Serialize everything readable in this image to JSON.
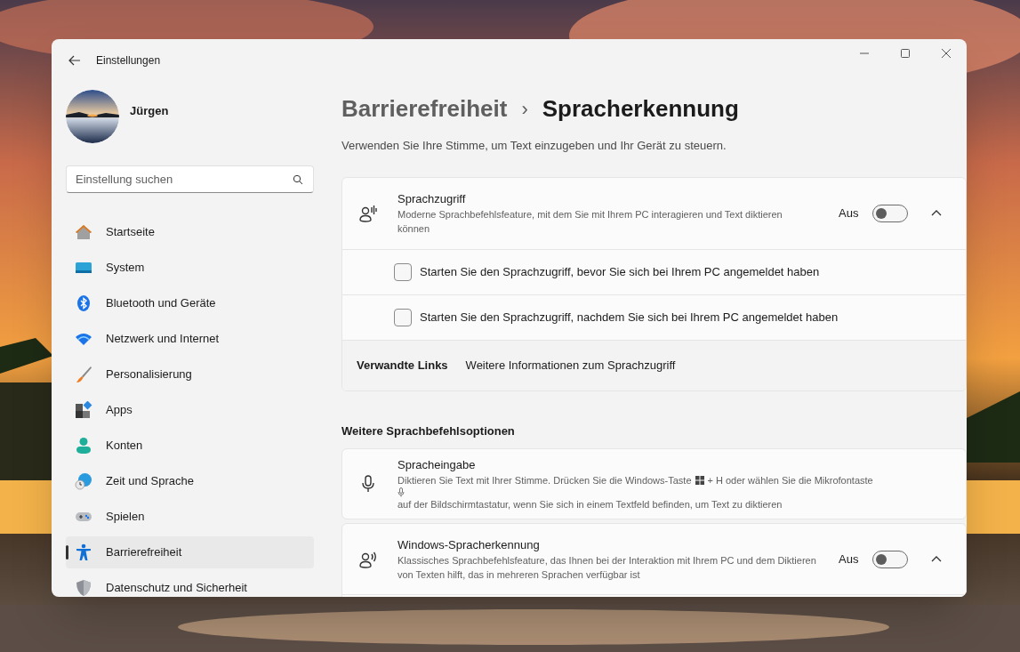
{
  "window": {
    "title": "Einstellungen"
  },
  "user": {
    "name": "Jürgen"
  },
  "search": {
    "placeholder": "Einstellung suchen"
  },
  "nav": [
    {
      "label": "Startseite",
      "selected": false
    },
    {
      "label": "System",
      "selected": false
    },
    {
      "label": "Bluetooth und Geräte",
      "selected": false
    },
    {
      "label": "Netzwerk und Internet",
      "selected": false
    },
    {
      "label": "Personalisierung",
      "selected": false
    },
    {
      "label": "Apps",
      "selected": false
    },
    {
      "label": "Konten",
      "selected": false
    },
    {
      "label": "Zeit und Sprache",
      "selected": false
    },
    {
      "label": "Spielen",
      "selected": false
    },
    {
      "label": "Barrierefreiheit",
      "selected": true
    },
    {
      "label": "Datenschutz und Sicherheit",
      "selected": false
    }
  ],
  "breadcrumb": {
    "parent": "Barrierefreiheit",
    "separator": "›",
    "current": "Spracherkennung"
  },
  "subtitle": "Verwenden Sie Ihre Stimme, um Text einzugeben und Ihr Gerät zu steuern.",
  "voice_access": {
    "title": "Sprachzugriff",
    "description": "Moderne Sprachbefehlsfeature, mit dem Sie mit Ihrem PC interagieren und Text diktieren können",
    "state_label": "Aus",
    "on": false,
    "expanded": true,
    "options": [
      {
        "label": "Starten Sie den Sprachzugriff, bevor Sie sich bei Ihrem PC angemeldet haben",
        "checked": false
      },
      {
        "label": "Starten Sie den Sprachzugriff, nachdem Sie sich bei Ihrem PC angemeldet haben",
        "checked": false
      }
    ],
    "related_links": {
      "label": "Verwandte Links",
      "links": [
        "Weitere Informationen zum Sprachzugriff"
      ]
    }
  },
  "section_title": "Weitere Sprachbefehlsoptionen",
  "voice_typing": {
    "title": "Spracheingabe",
    "description_parts": [
      {
        "kind": "text",
        "text": "Diktieren Sie Text mit Ihrer Stimme. Drücken Sie die Windows-Taste"
      },
      {
        "kind": "windows-key"
      },
      {
        "kind": "text",
        "text": "+ H oder wählen Sie die Mikrofontaste"
      },
      {
        "kind": "mic-key"
      },
      {
        "kind": "text",
        "text": "auf der Bildschirmtastatur, wenn Sie sich in einem Textfeld befinden, um Text zu diktieren"
      }
    ]
  },
  "speech_recognition": {
    "title": "Windows-Spracherkennung",
    "description": "Klassisches Sprachbefehlsfeature, das Ihnen bei der Interaktion mit Ihrem PC und dem Diktieren von Texten hilft, das in mehreren Sprachen verfügbar ist",
    "state_label": "Aus",
    "on": false,
    "expanded": true
  }
}
